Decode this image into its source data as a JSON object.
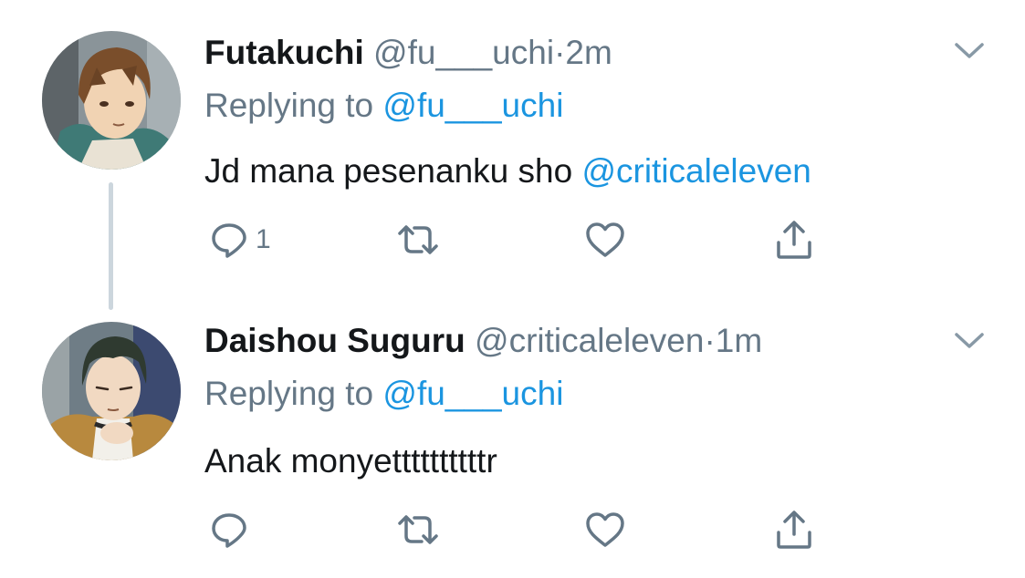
{
  "tweets": [
    {
      "display_name": "Futakuchi",
      "handle": "@fu___uchi",
      "separator": "·",
      "time": "2m",
      "replying_label": "Replying to",
      "replying_to": "@fu___uchi",
      "text": "Jd mana pesenanku sho ",
      "text_mention": "@criticaleleven",
      "reply_count": "1",
      "avatar_icon": "avatar-brown-hair-character",
      "icons": [
        "reply-icon",
        "retweet-icon",
        "like-icon",
        "share-icon",
        "chevron-down-icon"
      ]
    },
    {
      "display_name": "Daishou Suguru",
      "handle": "@criticaleleven",
      "separator": "·",
      "time": "1m",
      "replying_label": "Replying to",
      "replying_to": "@fu___uchi",
      "text": "Anak monyettttttttttr",
      "text_mention": "",
      "reply_count": "",
      "avatar_icon": "avatar-dark-hair-character",
      "icons": [
        "reply-icon",
        "retweet-icon",
        "like-icon",
        "share-icon",
        "chevron-down-icon"
      ]
    }
  ],
  "colors": {
    "text_primary": "#14171a",
    "text_secondary": "#657786",
    "link": "#1b95e0",
    "thread_line": "#ccd6dd",
    "background": "#ffffff"
  }
}
